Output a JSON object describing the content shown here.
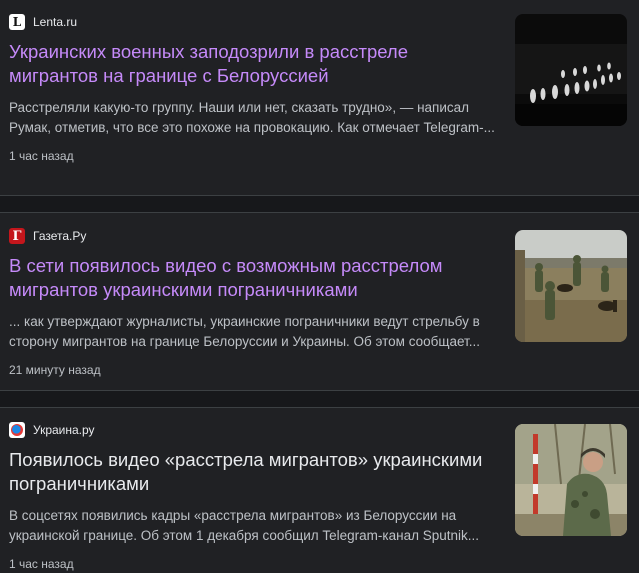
{
  "articles": [
    {
      "source": "Lenta.ru",
      "favicon": "lenta-favicon",
      "favicon_letter": "L",
      "title": "Украинских военных заподозрили в расстреле мигрантов на границе с Белоруссией",
      "snippet": "Расстреляли какую-то группу. Наши или нет, сказать трудно», — написал Румак, отметив, что все это похоже на провокацию. Как отмечает Telegram-...",
      "time": "1 час назад",
      "thumbnail": "night-thermal-image"
    },
    {
      "source": "Газета.Ру",
      "favicon": "gazeta-favicon",
      "favicon_letter": "Г",
      "title": "В сети появилось видео с возможным расстрелом мигрантов украинскими пограничниками",
      "snippet": "... как утверждают журналисты, украинские пограничники ведут стрельбу в сторону мигрантов на границе Белоруссии и Украины. Об этом сообщает...",
      "time": "21 минуту назад",
      "thumbnail": "border-guards-field-photo"
    },
    {
      "source": "Украина.ру",
      "favicon": "ukraina-favicon",
      "title": "Появилось видео «расстрела мигрантов» украинскими пограничниками",
      "snippet": "В соцсетях появились кадры «расстрела мигрантов» из Белоруссии на украинской границе. Об этом 1 декабря сообщил Telegram-канал Sputnik...",
      "time": "1 час назад",
      "thumbnail": "border-guard-soldier-photo"
    }
  ],
  "colors": {
    "background": "#202124",
    "visited_title": "#c58af9",
    "title": "#e8eaed",
    "snippet": "#bdc1c6"
  }
}
